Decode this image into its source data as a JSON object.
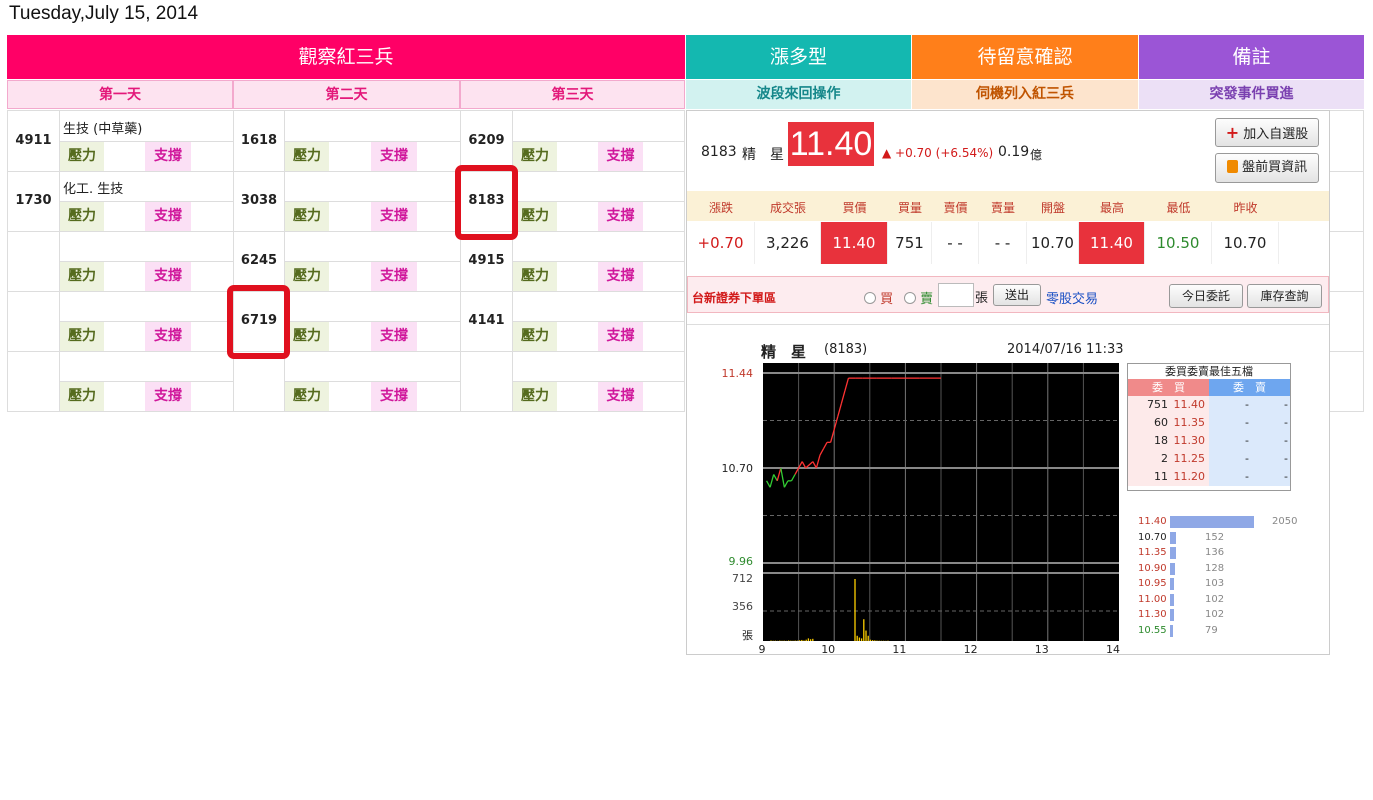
{
  "date": "Tuesday,July 15, 2014",
  "headers": {
    "main": "觀察紅三兵",
    "rise": "漲多型",
    "wait": "待留意確認",
    "note": "備註"
  },
  "subheaders": {
    "day1": "第一天",
    "day2": "第二天",
    "day3": "第三天",
    "rise_sub": "波段來回操作",
    "wait_sub": "伺機列入紅三兵",
    "note_sub": "突發事件買進"
  },
  "labels": {
    "pressure": "壓力",
    "support": "支撐"
  },
  "day1": [
    {
      "code": "4911",
      "industry": "生技 (中草藥)"
    },
    {
      "code": "1730",
      "industry": "化工. 生技"
    },
    {
      "code": "",
      "industry": ""
    },
    {
      "code": "",
      "industry": ""
    },
    {
      "code": "",
      "industry": ""
    }
  ],
  "day2": [
    "1618",
    "3038",
    "6245",
    "6719"
  ],
  "day3": [
    "6209",
    "8183",
    "4915",
    "4141"
  ],
  "quote": {
    "code": "8183",
    "name": "精　星",
    "price": "11.40",
    "change": "▲ +0.70 (+6.54%)",
    "amount": "0.19",
    "amount_unit": "億",
    "add_btn": "加入自選股",
    "info_btn": "盤前買資訊",
    "cols": [
      "漲跌",
      "成交張",
      "買價",
      "買量",
      "賣價",
      "賣量",
      "開盤",
      "最高",
      "最低",
      "昨收"
    ],
    "vals": [
      "+0.70",
      "3,226",
      "11.40",
      "751",
      "- -",
      "- -",
      "10.70",
      "11.40",
      "10.50",
      "10.70"
    ]
  },
  "order": {
    "broker": "台新證券下單區",
    "buy": "買",
    "sell": "賣",
    "unit": "張",
    "submit": "送出",
    "odd_lot": "零股交易",
    "today_orders": "今日委託",
    "inventory": "庫存查詢"
  },
  "chart": {
    "name": "精　星",
    "code": "(8183)",
    "datetime": "2014/07/16 11:33",
    "price_ticks": [
      "11.44",
      "10.70",
      "9.96"
    ],
    "vol_ticks": [
      "712",
      "356",
      "張"
    ],
    "x_ticks": [
      "9",
      "10",
      "11",
      "12",
      "13",
      "14"
    ]
  },
  "chart_data": {
    "type": "line",
    "title": "精　星 (8183)",
    "ylim": [
      9.96,
      11.44
    ],
    "x_range": [
      9,
      14
    ],
    "series": [],
    "x": [
      9.05,
      9.1,
      9.15,
      9.2,
      9.25,
      9.3,
      9.35,
      9.4,
      9.45,
      9.5,
      9.55,
      9.6,
      9.7,
      9.75,
      9.8,
      9.85,
      9.9,
      9.95,
      10.0,
      10.05,
      10.1,
      10.15,
      10.2,
      10.3,
      10.4,
      10.6,
      10.8,
      11.0,
      11.2,
      11.5
    ],
    "y": [
      10.6,
      10.55,
      10.65,
      10.6,
      10.7,
      10.55,
      10.6,
      10.6,
      10.65,
      10.7,
      10.75,
      10.7,
      10.75,
      10.7,
      10.8,
      10.85,
      10.9,
      10.9,
      11.0,
      11.1,
      11.2,
      11.3,
      11.4,
      11.4,
      11.4,
      11.4,
      11.4,
      11.4,
      11.4,
      11.4
    ],
    "volume_ylim": [
      0,
      712
    ]
  },
  "book": {
    "title": "委買委賣最佳五檔",
    "buy_head": "委　買",
    "sell_head": "委　賣",
    "rows": [
      {
        "qty": "751",
        "price": "11.40",
        "sp": "-",
        "sq": "-"
      },
      {
        "qty": "60",
        "price": "11.35",
        "sp": "-",
        "sq": "-"
      },
      {
        "qty": "18",
        "price": "11.30",
        "sp": "-",
        "sq": "-"
      },
      {
        "qty": "2",
        "price": "11.25",
        "sp": "-",
        "sq": "-"
      },
      {
        "qty": "11",
        "price": "11.20",
        "sp": "-",
        "sq": "-"
      }
    ]
  },
  "distribution": [
    {
      "price": "11.40",
      "vol": "2050",
      "color": "#c0392b",
      "frac": 1.0
    },
    {
      "price": "10.70",
      "vol": "152",
      "color": "#222222",
      "frac": 0.074
    },
    {
      "price": "11.35",
      "vol": "136",
      "color": "#c0392b",
      "frac": 0.066
    },
    {
      "price": "10.90",
      "vol": "128",
      "color": "#c0392b",
      "frac": 0.062
    },
    {
      "price": "10.95",
      "vol": "103",
      "color": "#c0392b",
      "frac": 0.05
    },
    {
      "price": "11.00",
      "vol": "102",
      "color": "#c0392b",
      "frac": 0.05
    },
    {
      "price": "11.30",
      "vol": "102",
      "color": "#c0392b",
      "frac": 0.05
    },
    {
      "price": "10.55",
      "vol": "79",
      "color": "#2e8b2e",
      "frac": 0.039
    }
  ]
}
